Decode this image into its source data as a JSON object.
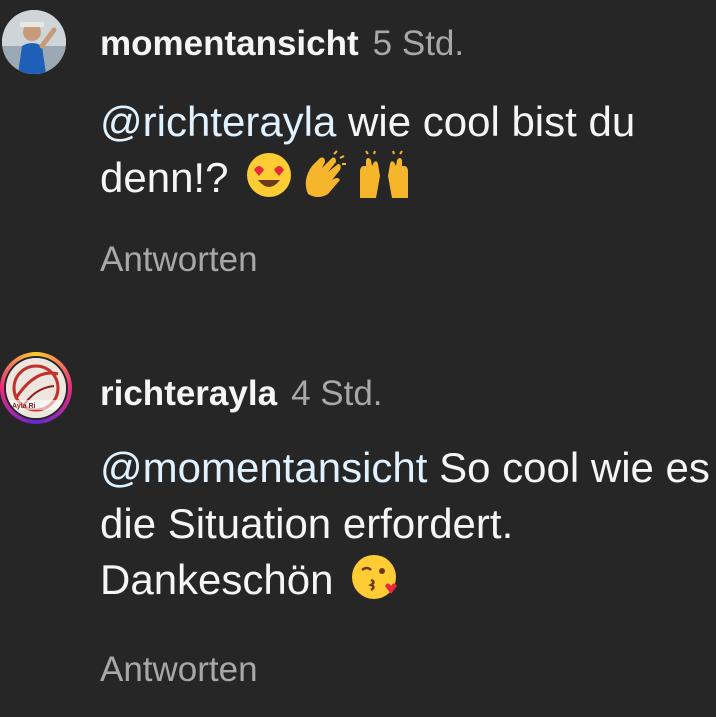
{
  "comments": [
    {
      "username": "momentansicht",
      "time": "5 Std.",
      "mention": "@richterayla",
      "text": " wie cool bist du denn!?",
      "emojis": [
        "heart-eyes-emoji",
        "clapping-hands-emoji",
        "raising-hands-emoji"
      ],
      "reply_label": "Antworten"
    },
    {
      "username": "richterayla",
      "time": "4 Std.",
      "avatar_caption": "Ayla Ri",
      "mention": "@momentansicht",
      "text": " So cool wie es die Situation erfordert. Dankeschön",
      "emojis": [
        "kissing-heart-emoji"
      ],
      "reply_label": "Antworten"
    }
  ],
  "colors": {
    "background": "#262626",
    "text": "#f5f5f5",
    "secondary": "#a8a8a8",
    "mention": "#e0f1ff"
  }
}
